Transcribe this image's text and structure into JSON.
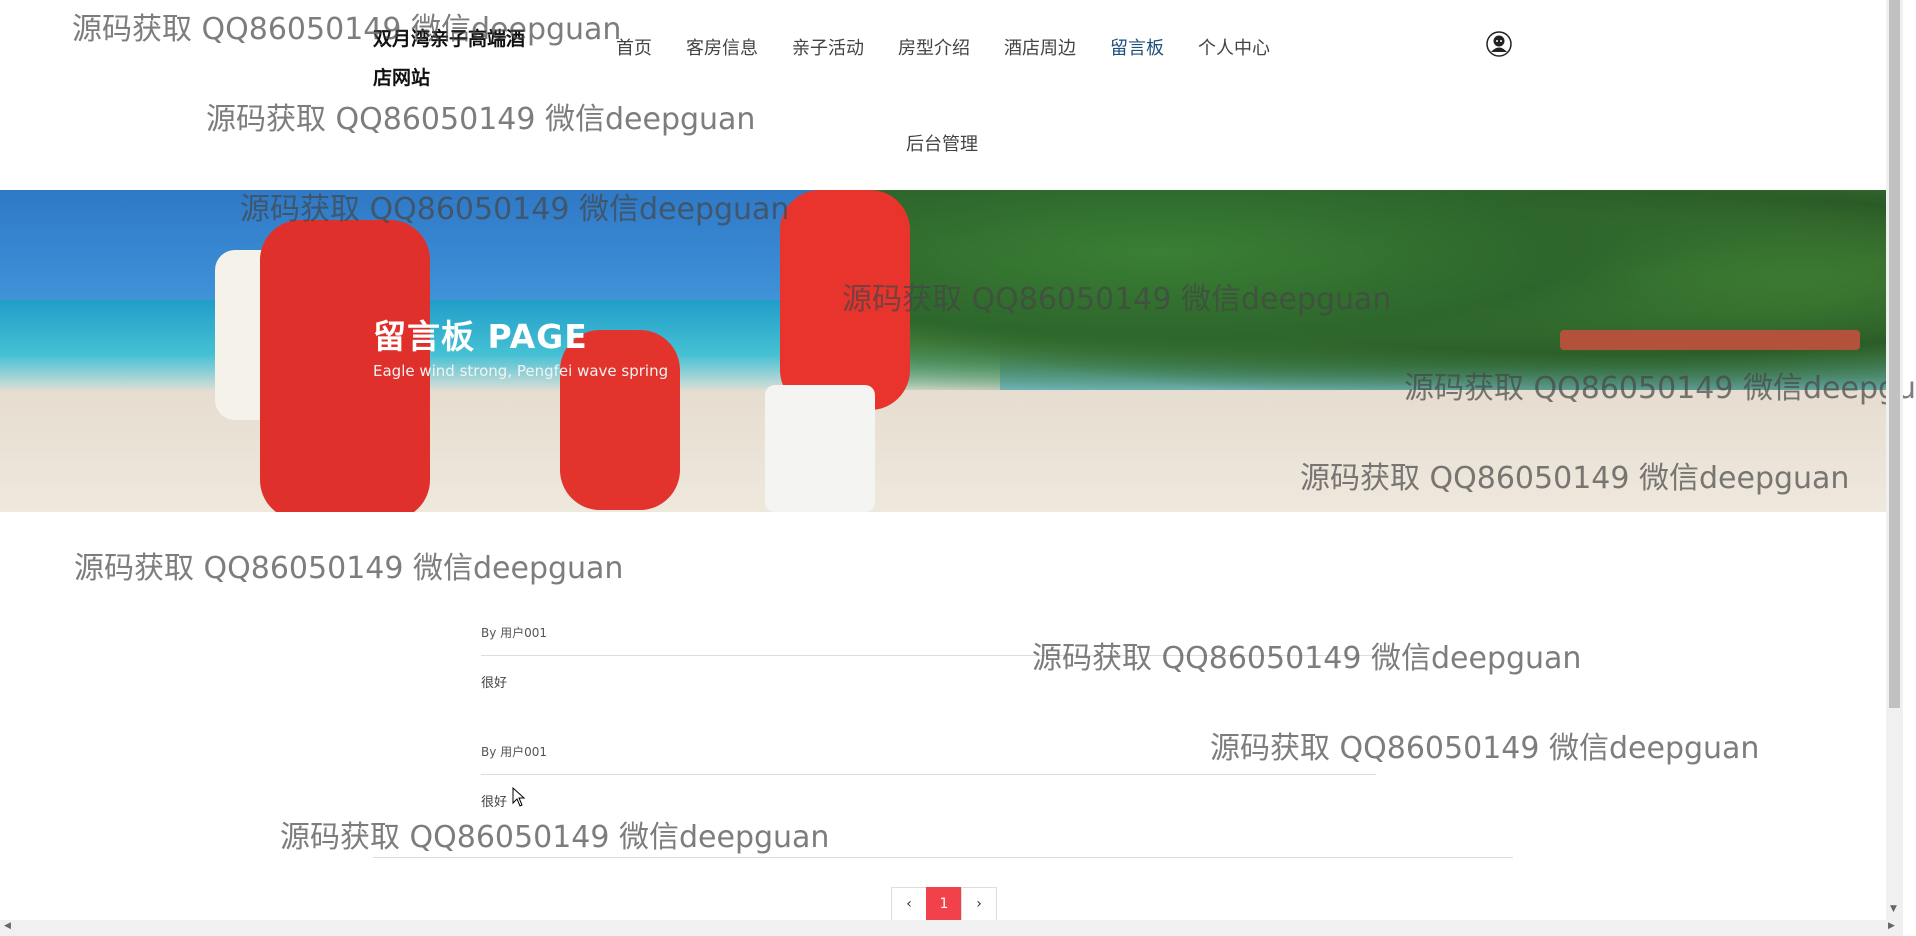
{
  "site": {
    "title": "双月湾亲子高端酒店网站"
  },
  "nav": {
    "items": [
      "首页",
      "客房信息",
      "亲子活动",
      "房型介绍",
      "酒店周边",
      "留言板",
      "个人中心"
    ],
    "second_row": "后台管理",
    "active": "留言板",
    "user_icon": "user-avatar-icon"
  },
  "banner": {
    "title": "留言板 PAGE",
    "subtitle": "Eagle wind strong, Pengfei wave spring"
  },
  "messages": [
    {
      "author": "By 用户001",
      "text": "很好"
    },
    {
      "author": "By 用户001",
      "text": "很好"
    }
  ],
  "pagination": {
    "prev": "‹",
    "current": "1",
    "next": "›"
  },
  "watermark": "源码获取 QQ86050149 微信deepguan",
  "colors": {
    "active_nav": "#1f4f7a",
    "pager_active": "#f1414b"
  }
}
